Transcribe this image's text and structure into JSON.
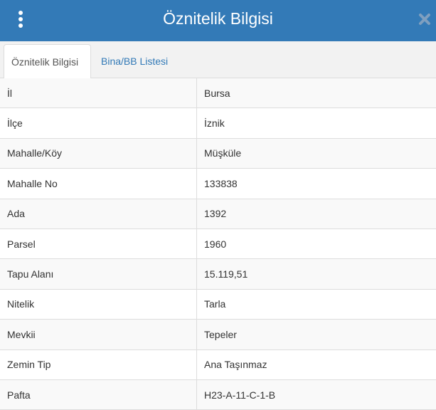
{
  "header": {
    "title": "Öznitelik Bilgisi",
    "menu_icon": "vertical-dots-icon",
    "close_icon": "close-icon",
    "background_color": "#337ab7"
  },
  "tabs": [
    {
      "label": "Öznitelik Bilgisi",
      "active": true
    },
    {
      "label": "Bina/BB Listesi",
      "active": false
    }
  ],
  "attributes": [
    {
      "key": "İl",
      "value": "Bursa"
    },
    {
      "key": "İlçe",
      "value": "İznik"
    },
    {
      "key": "Mahalle/Köy",
      "value": "Müşküle"
    },
    {
      "key": "Mahalle No",
      "value": "133838"
    },
    {
      "key": "Ada",
      "value": "1392"
    },
    {
      "key": "Parsel",
      "value": "1960"
    },
    {
      "key": "Tapu Alanı",
      "value": "15.119,51"
    },
    {
      "key": "Nitelik",
      "value": "Tarla"
    },
    {
      "key": "Mevkii",
      "value": "Tepeler"
    },
    {
      "key": "Zemin Tip",
      "value": "Ana Taşınmaz"
    },
    {
      "key": "Pafta",
      "value": "H23-A-11-C-1-B"
    }
  ]
}
